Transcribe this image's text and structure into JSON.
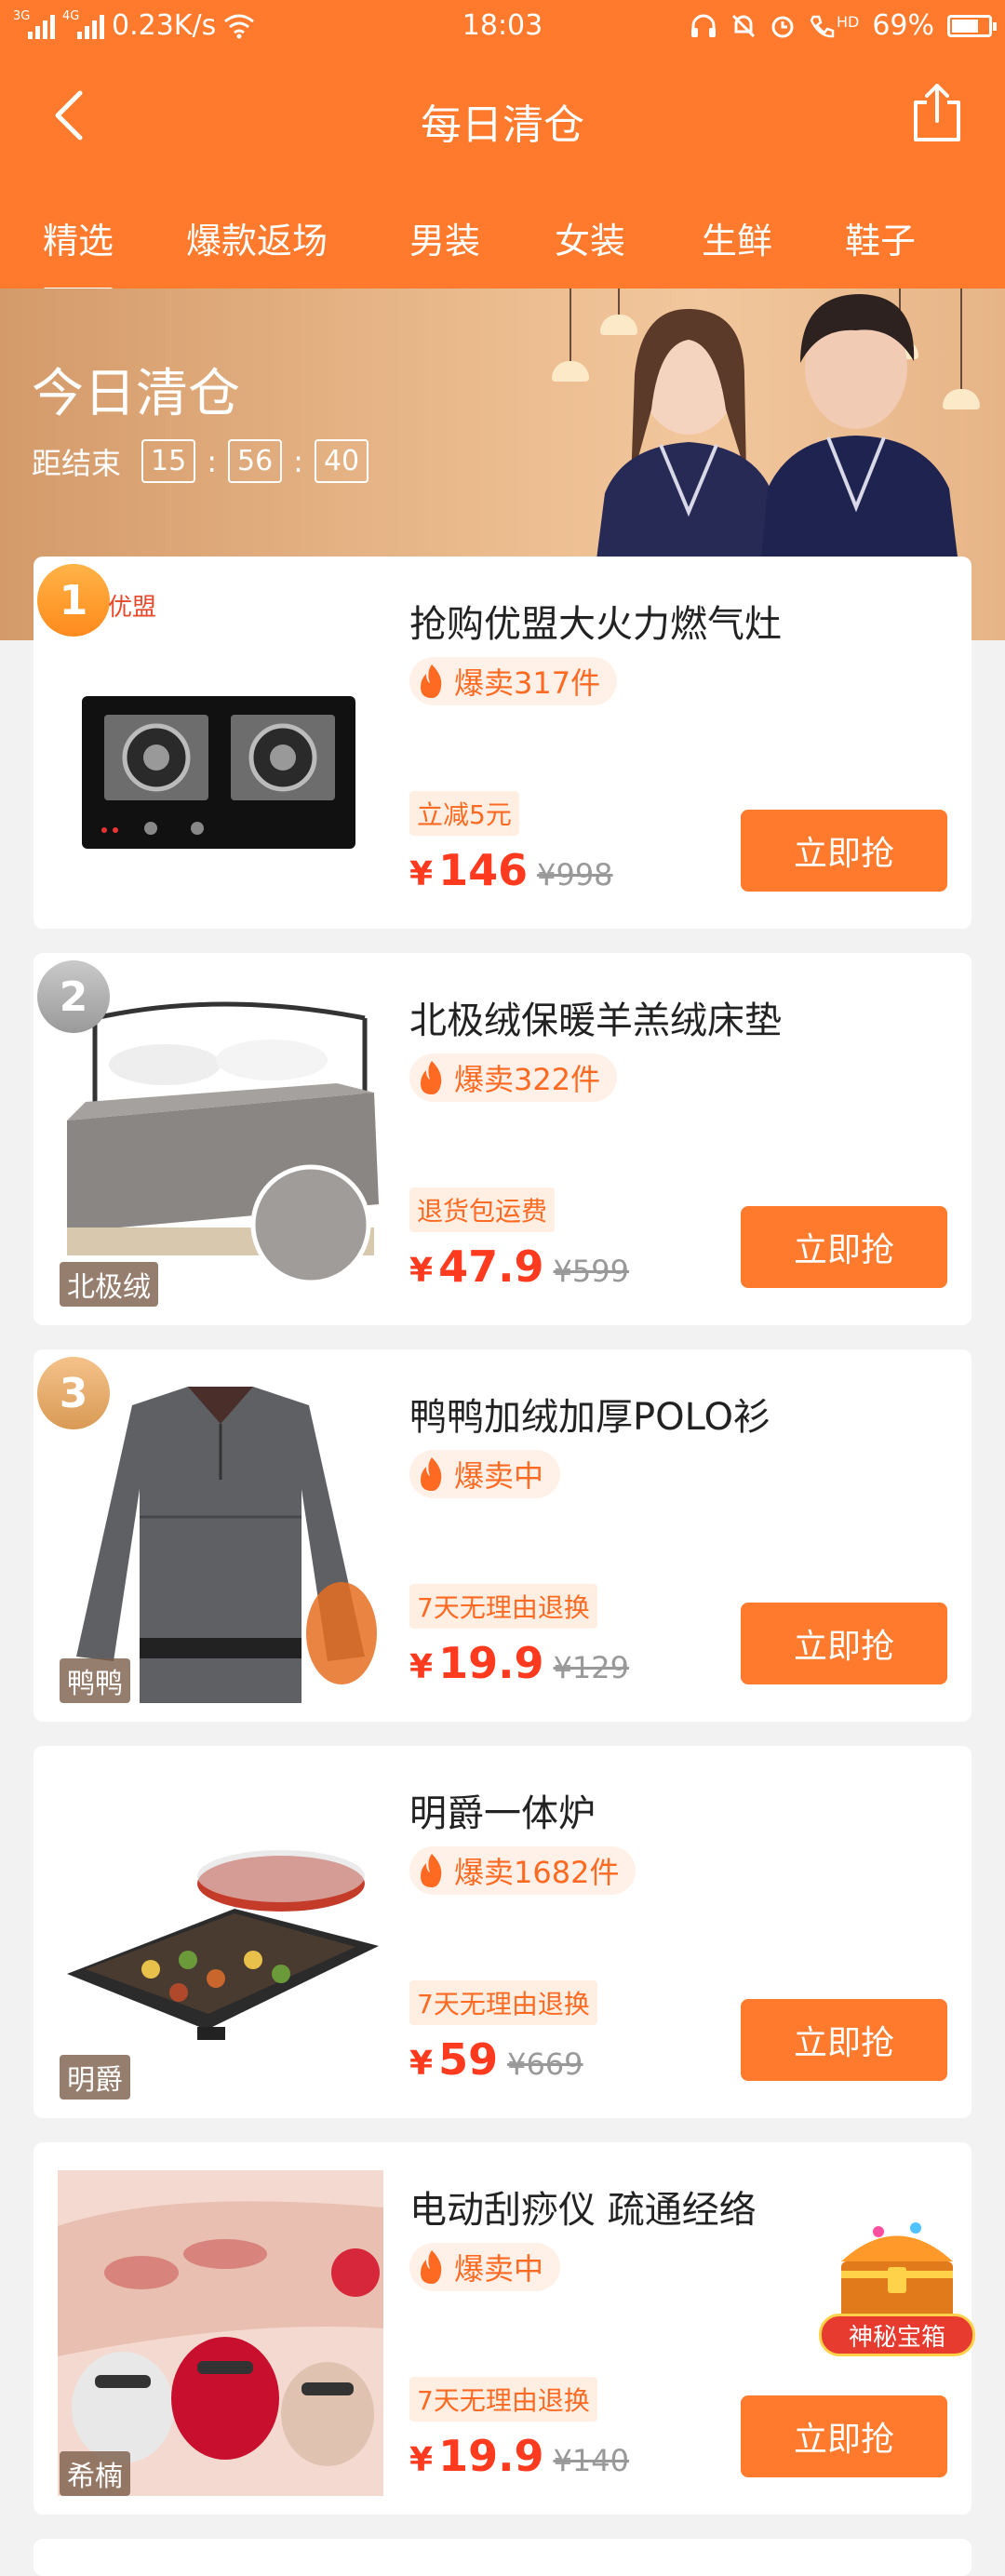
{
  "status_bar": {
    "network_left": "3G",
    "network_right": "4G",
    "speed": "0.23K/s",
    "time": "18:03",
    "hd": "HD",
    "battery": "69%",
    "battery_level": 0.69
  },
  "header": {
    "title": "每日清仓"
  },
  "tabs": [
    {
      "label": "精选",
      "active": true
    },
    {
      "label": "爆款返场"
    },
    {
      "label": "男装"
    },
    {
      "label": "女装"
    },
    {
      "label": "生鲜"
    },
    {
      "label": "鞋子"
    }
  ],
  "banner": {
    "title": "今日清仓",
    "countdown_label": "距结束",
    "hours": "15",
    "minutes": "56",
    "seconds": "40",
    "separator": ":"
  },
  "products": [
    {
      "rank": "1",
      "brand": "优盟",
      "name": "抢购优盟大火力燃气灶",
      "hot": "爆卖317件",
      "tag": "立减5元",
      "currency": "¥",
      "price": "146",
      "original": "¥998",
      "button": "立即抢"
    },
    {
      "rank": "2",
      "image_label": "北极绒",
      "name": "北极绒保暖羊羔绒床垫",
      "hot": "爆卖322件",
      "tag": "退货包运费",
      "currency": "¥",
      "price": "47.9",
      "original": "¥599",
      "button": "立即抢"
    },
    {
      "rank": "3",
      "image_label": "鸭鸭",
      "name": "鸭鸭加绒加厚POLO衫",
      "hot": "爆卖中",
      "tag": "7天无理由退换",
      "currency": "¥",
      "price": "19.9",
      "original": "¥129",
      "button": "立即抢"
    },
    {
      "image_label": "明爵",
      "name": "明爵一体炉",
      "hot": "爆卖1682件",
      "tag": "7天无理由退换",
      "currency": "¥",
      "price": "59",
      "original": "¥669",
      "button": "立即抢"
    },
    {
      "image_label": "希楠",
      "name": "电动刮痧仪 疏通经络",
      "hot": "爆卖中",
      "tag": "7天无理由退换",
      "currency": "¥",
      "price": "19.9",
      "original": "¥140",
      "button": "立即抢"
    }
  ],
  "treasure_box": {
    "label": "神秘宝箱"
  },
  "colors": {
    "primary": "#ff7a2c",
    "price": "#ff3a1e",
    "hot": "#ff6a22",
    "page_bg": "#f2f2f2"
  }
}
